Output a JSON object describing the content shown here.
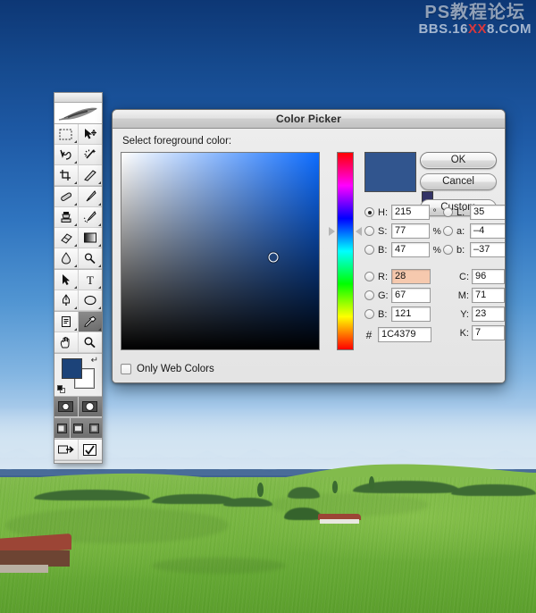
{
  "watermark": {
    "chinese": "PS教程论坛",
    "url_prefix": "BBS.16",
    "url_red": "XX",
    "url_suffix": "8.COM"
  },
  "toolbar": {
    "name": "photoshop-toolbox",
    "foreground_color": "#1C4379",
    "background_color": "#FFFFFF",
    "tools": [
      {
        "name": "marquee-tool",
        "glyph": "marquee"
      },
      {
        "name": "move-tool",
        "glyph": "move"
      },
      {
        "name": "lasso-tool",
        "glyph": "lasso"
      },
      {
        "name": "magic-wand-tool",
        "glyph": "wand"
      },
      {
        "name": "crop-tool",
        "glyph": "crop"
      },
      {
        "name": "slice-tool",
        "glyph": "slice"
      },
      {
        "name": "healing-brush-tool",
        "glyph": "heal"
      },
      {
        "name": "brush-tool",
        "glyph": "brush"
      },
      {
        "name": "clone-stamp-tool",
        "glyph": "stamp"
      },
      {
        "name": "history-brush-tool",
        "glyph": "historybrush"
      },
      {
        "name": "eraser-tool",
        "glyph": "eraser"
      },
      {
        "name": "gradient-tool",
        "glyph": "gradient"
      },
      {
        "name": "blur-tool",
        "glyph": "blur"
      },
      {
        "name": "dodge-tool",
        "glyph": "dodge"
      },
      {
        "name": "path-selection-tool",
        "glyph": "pathselect"
      },
      {
        "name": "type-tool",
        "glyph": "type"
      },
      {
        "name": "pen-tool",
        "glyph": "pen"
      },
      {
        "name": "shape-tool",
        "glyph": "ellipseshape"
      },
      {
        "name": "notes-tool",
        "glyph": "notes"
      },
      {
        "name": "eyedropper-tool",
        "glyph": "eyedropper"
      },
      {
        "name": "hand-tool",
        "glyph": "hand"
      },
      {
        "name": "zoom-tool",
        "glyph": "zoom"
      }
    ],
    "selected_tool": "eyedropper-tool",
    "screen_modes": [
      "standard-screen-mode",
      "full-screen-mode"
    ],
    "quick_mask_modes": [
      "standard-mode",
      "quick-mask-mode",
      "extra-mode"
    ],
    "jump_to": [
      "jump-to-imageready",
      "check-tool"
    ]
  },
  "picker": {
    "title": "Color Picker",
    "hint": "Select foreground color:",
    "buttons": {
      "ok": "OK",
      "cancel": "Cancel",
      "custom": "Custom"
    },
    "preview_color": "#31558E",
    "web_safe_color": "#333366",
    "hue_css": "#0d6cff",
    "marker": {
      "saturation_pct": 77,
      "brightness_pct": 47
    },
    "hue_position_pct": 40.3,
    "fields": {
      "hsb": [
        {
          "name": "hue-field",
          "label": "H:",
          "value": "215",
          "unit": "°",
          "selected": true
        },
        {
          "name": "saturation-field",
          "label": "S:",
          "value": "77",
          "unit": "%",
          "selected": false
        },
        {
          "name": "brightness-field",
          "label": "B:",
          "value": "47",
          "unit": "%",
          "selected": false
        }
      ],
      "lab": [
        {
          "name": "lightness-field",
          "label": "L:",
          "value": "35",
          "unit": "",
          "selected": false
        },
        {
          "name": "lab-a-field",
          "label": "a:",
          "value": "–4",
          "unit": "",
          "selected": false
        },
        {
          "name": "lab-b-field",
          "label": "b:",
          "value": "–37",
          "unit": "",
          "selected": false
        }
      ],
      "rgb": [
        {
          "name": "red-field",
          "label": "R:",
          "value": "28",
          "unit": "",
          "selected": false,
          "highlight": true
        },
        {
          "name": "green-field",
          "label": "G:",
          "value": "67",
          "unit": "",
          "selected": false,
          "highlight": false
        },
        {
          "name": "blue-field",
          "label": "B:",
          "value": "121",
          "unit": "",
          "selected": false,
          "highlight": false
        }
      ],
      "cmyk": [
        {
          "name": "cyan-field",
          "label": "C:",
          "value": "96",
          "unit": "%"
        },
        {
          "name": "magenta-field",
          "label": "M:",
          "value": "71",
          "unit": "%"
        },
        {
          "name": "yellow-field",
          "label": "Y:",
          "value": "23",
          "unit": "%"
        },
        {
          "name": "black-field",
          "label": "K:",
          "value": "7",
          "unit": "%"
        }
      ],
      "hex": {
        "name": "hex-field",
        "label": "#",
        "value": "1C4379"
      }
    },
    "only_web_colors": {
      "label": "Only Web Colors",
      "checked": false
    }
  },
  "desktop": {
    "scene": "alpine-meadow-landscape",
    "sky_top": "#0d3775",
    "sky_bottom": "#d8e6f2",
    "grass": "#70b03c"
  }
}
